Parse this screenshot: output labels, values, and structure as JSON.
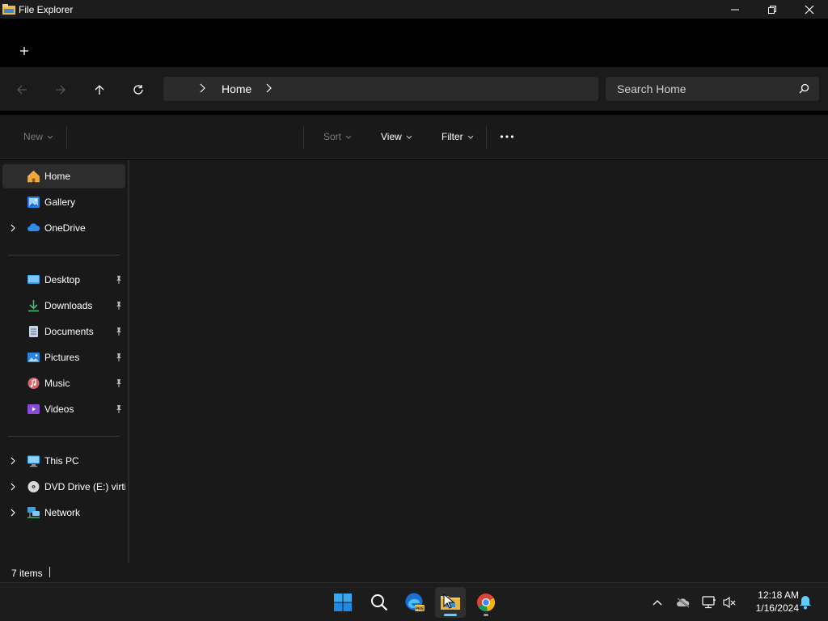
{
  "window": {
    "title": "File Explorer"
  },
  "address": {
    "crumb": "Home"
  },
  "search": {
    "placeholder": "Search Home"
  },
  "toolbar": {
    "new_label": "New",
    "sort_label": "Sort",
    "view_label": "View",
    "filter_label": "Filter"
  },
  "sidebar": {
    "top": [
      {
        "label": "Home",
        "icon": "home-icon"
      },
      {
        "label": "Gallery",
        "icon": "gallery-icon"
      },
      {
        "label": "OneDrive",
        "icon": "onedrive-icon"
      }
    ],
    "quick_access": [
      {
        "label": "Desktop",
        "icon": "desktop-icon"
      },
      {
        "label": "Downloads",
        "icon": "downloads-icon"
      },
      {
        "label": "Documents",
        "icon": "documents-icon"
      },
      {
        "label": "Pictures",
        "icon": "pictures-icon"
      },
      {
        "label": "Music",
        "icon": "music-icon"
      },
      {
        "label": "Videos",
        "icon": "videos-icon"
      }
    ],
    "devices": [
      {
        "label": "This PC",
        "icon": "pc-icon"
      },
      {
        "label": "DVD Drive (E:) virtio",
        "icon": "dvd-icon"
      },
      {
        "label": "Network",
        "icon": "network-icon"
      }
    ]
  },
  "status": {
    "item_count": "7 items"
  },
  "taskbar": {
    "time": "12:18 AM",
    "date": "1/16/2024"
  },
  "colors": {
    "accent": "#60cdff",
    "folder_yellow": "#f2c94c"
  }
}
